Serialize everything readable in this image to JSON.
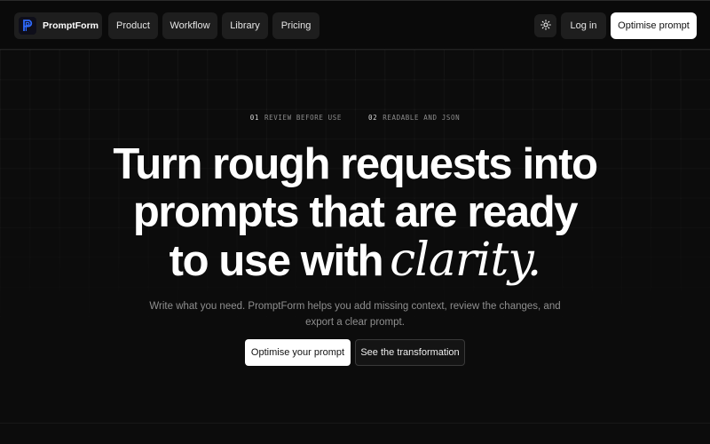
{
  "nav": {
    "brand": "PromptForm",
    "brand_icon": "p-logo-icon",
    "links": [
      "Product",
      "Workflow",
      "Library",
      "Pricing"
    ],
    "theme_icon": "sun-icon",
    "login": "Log in",
    "cta": "Optimise prompt"
  },
  "hero": {
    "tags": [
      {
        "num": "01",
        "label": "REVIEW BEFORE USE"
      },
      {
        "num": "02",
        "label": "READABLE AND JSON"
      }
    ],
    "headline_line1": "Turn rough requests into",
    "headline_line2": "prompts that are ready",
    "headline_line3": "to use with",
    "headline_accent": "clarity.",
    "subtitle": "Write what you need. PromptForm helps you add missing context, review the changes, and export a clear prompt.",
    "primary_button": "Optimise your prompt",
    "secondary_button": "See the transformation"
  },
  "colors": {
    "background": "#0c0c0c",
    "accent": "#2f6bff",
    "primary_button": "#ffffff"
  }
}
